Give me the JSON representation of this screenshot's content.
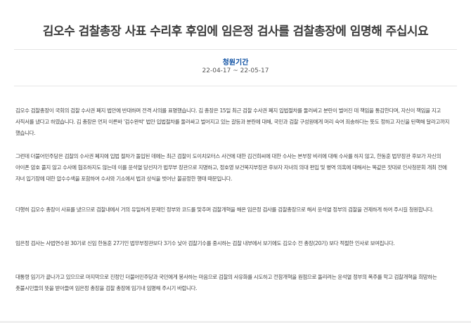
{
  "petition": {
    "title": "김오수 검찰총장 사표 수리후 후임에 임은정 검사를 검찰총장에 임명해 주십시요",
    "period_label": "청원기간",
    "period_dates": "22-04-17 ~ 22-05-17"
  },
  "body": {
    "paragraphs": [
      "김오수 검찰총장이 국회의 검찰 수사권 폐지 법안에 반대하며 전격 사의를 표명했습니다. 김 총장은 15일 최근 검찰 수사권 폐지 입법절차를 둘러싸고 분란이 벌어진 데 책임을 통감한다며, 자신이 책임을 지고 사직서를 냈다고 하였습니다. 김 총장은 먼저 이른바 '검수완박' 법안 입법절차를 둘러싸고 벌어지고 있는 갈등과 분란에 대해, 국민과 검찰 구성원에게 머리 숙여 죄송하다는 뜻도 정하고 자신을 탄핵해 달라고까지 했습니다.",
      "그런데 더불어민주당은 검찰의 수사권 폐지에 입법 절차가 돌입된 데에는 최근 검찰이 도이치모터스 사건에 대한 김건희씨에 대한 수사는 본부장 비리에 대해 수사를 하지 않고, 한동훈 법무장관 후보가 자신의 아이폰 암호 풀지 않고 수사에 협조하지도 않는데 이를 윤석열 당선자가 법무부 장관으로 지명하고, 정호영 보건복지부장관 후보자 자녀의 의대 편입 및 병역 의혹에 대해서는 똑같은 잣대로 인사청문회 개최 전에 자녀 입기장에 대한 압수수색을 포함하여 수사와 기소에서 법과 상식을 벗어난 불공정한 행태 때문입니다.",
      "다행히 김오수 총장이 사표를 냈으므로 검찰내에서 거의 유일하게 문재인 정부와 코드를 맞추며 검찰개혁을 해온 임은정 검사를 검찰총장으로 해서 윤석열 정부의 검찰을 견제하게 하여 주시길 청원합니다.",
      "임은정 검사는 사법연수원 30기로 신임 한동훈 27기인 법무부장관보다 3기수 낮아 검찰기수를 중시하는 검찰 내부에서 보기에도 김오수 전 총장(20기) 보다 적절한 인사로 보여집니다.",
      "대통령 임기가 끝나가고 있으므로 마지막으로 진정인 더불어민주당과 국민에게 봉사하는 마음으로 검찰의 사유화를 시도하고 전참개혁을 원점으로 돌리려는 윤석열 정부의 폭주를 막고 검찰개혁을 희망하는 촛불시민들의 뜻을 받아들여 임은정 총장을 검찰 총장에 임기내 임명해 주시기 바랍니다."
    ]
  }
}
